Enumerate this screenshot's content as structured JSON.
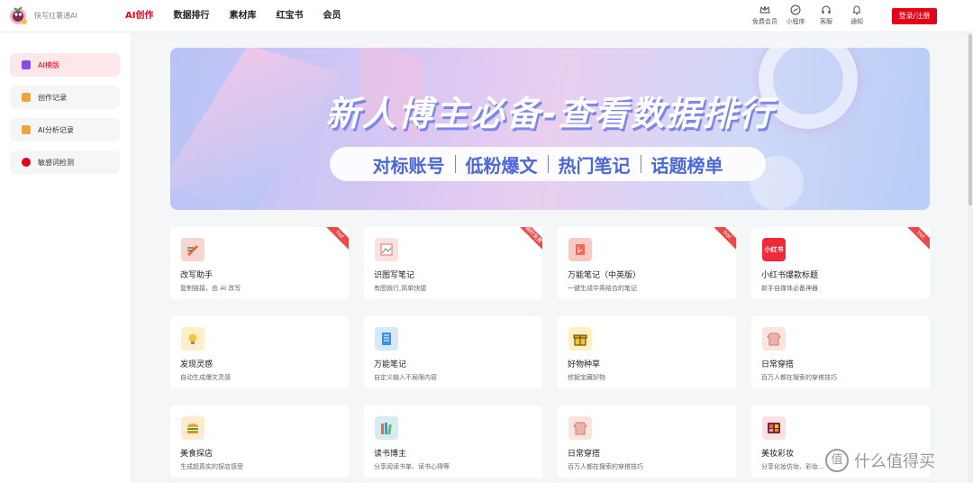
{
  "header": {
    "logo_text": "快写红薯通AI",
    "nav": [
      {
        "label": "AI创作",
        "active": true
      },
      {
        "label": "数据排行",
        "active": false
      },
      {
        "label": "素材库",
        "active": false
      },
      {
        "label": "红宝书",
        "active": false
      },
      {
        "label": "会员",
        "active": false
      }
    ],
    "tools": [
      {
        "label": "免费会员",
        "icon": "crown-icon"
      },
      {
        "label": "小程序",
        "icon": "mini-program-icon"
      },
      {
        "label": "客服",
        "icon": "headset-icon"
      },
      {
        "label": "通知",
        "icon": "bell-icon"
      }
    ],
    "login_label": "登录/注册"
  },
  "sidebar": {
    "items": [
      {
        "label": "AI模版",
        "active": true,
        "color": "#8a4be8"
      },
      {
        "label": "创作记录",
        "active": false,
        "color": "#f2a33a"
      },
      {
        "label": "AI分析记录",
        "active": false,
        "color": "#f2a33a"
      },
      {
        "label": "敏感词检测",
        "active": false,
        "color": "#e5001a"
      }
    ]
  },
  "banner": {
    "title": "新人博主必备-查看数据排行",
    "tags": [
      "对标账号",
      "低粉爆文",
      "热门笔记",
      "话题榜单"
    ]
  },
  "cards": [
    {
      "title": "改写助手",
      "desc": "复制链接，由 AI 改写",
      "badge": "hot",
      "icon": "rewrite-icon",
      "color": "#f6d6cf"
    },
    {
      "title": "识图写笔记",
      "desc": "有图就行,简单快捷",
      "badge": "限时免费",
      "icon": "image-note-icon",
      "color": "#fbe1df"
    },
    {
      "title": "万能笔记（中英版）",
      "desc": "一键生成中英结合的笔记",
      "badge": "hot",
      "icon": "bilingual-note-icon",
      "color": "#f7c9c2"
    },
    {
      "title": "小红书爆款标题",
      "desc": "新手自媒体必备神器",
      "badge": "hot",
      "icon": "xiaohongshu-icon",
      "color": "#ee2a3a",
      "icon_text": "小红书"
    },
    {
      "title": "发现灵感",
      "desc": "自动生成爆文灵感",
      "badge": "",
      "icon": "lightbulb-icon",
      "color": "#fdf0c8"
    },
    {
      "title": "万能笔记",
      "desc": "自定义输入不局限内容",
      "badge": "",
      "icon": "notebook-icon",
      "color": "#d6e9fb"
    },
    {
      "title": "好物种草",
      "desc": "挖掘宝藏好物",
      "badge": "",
      "icon": "gift-icon",
      "color": "#fdf0c0"
    },
    {
      "title": "日常穿搭",
      "desc": "百万人都在搜索的穿搭技巧",
      "badge": "",
      "icon": "sweater-icon",
      "color": "#fbe3de"
    },
    {
      "title": "美食探店",
      "desc": "生成超真实的探店感受",
      "badge": "",
      "icon": "burger-icon",
      "color": "#fdeccf"
    },
    {
      "title": "读书博主",
      "desc": "分享阅读书单、读书心得等",
      "badge": "",
      "icon": "books-icon",
      "color": "#d7ecf0"
    },
    {
      "title": "日常穿搭",
      "desc": "百万人都在搜索的穿搭技巧",
      "badge": "",
      "icon": "sweater-icon",
      "color": "#fbe3de"
    },
    {
      "title": "美妆彩妆",
      "desc": "分享化妆仿妆、彩妆...",
      "badge": "",
      "icon": "makeup-palette-icon",
      "color": "#fbe0e4"
    }
  ],
  "watermark": {
    "badge": "值",
    "text": "什么值得买"
  }
}
